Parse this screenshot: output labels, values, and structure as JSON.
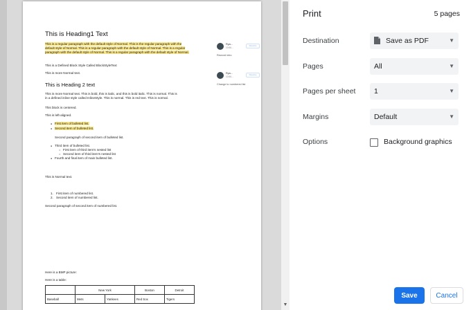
{
  "preview": {
    "heading1": "This is Heading1 Text",
    "normal_para": "This is a regular paragraph with the default style of Normal. This is the regular paragraph with the default style of Normal. This is a regular paragraph with the default style of Normal. This is a regular paragraph with the default style of Normal. This is a regular paragraph with the default style of Normal.",
    "block_style": "This is a Defined Block Style Called BlockStyleText",
    "more_normal": "This is more Normal text.",
    "heading2": "This is Heading 2 text",
    "inline_line1": "This is more Normal text. This is bold, this is italic, and this is bold italic. This is normal. This is",
    "inline_line2": "in a defined inline style called InlineStyle. This is normal. This is red text. This is normal.",
    "centered": "This block is centered.",
    "left_aligned": "This is left-aligned.",
    "bullet1": "First item of bulleted list.",
    "bullet2": "Second item of bulleted list.",
    "bullet2_para": "Second paragraph of second item of bulleted list.",
    "bullet3": "Third item of bulleted list.",
    "nested1": "First item of third item's nested list",
    "nested2": "Second item of third item's nested list",
    "bullet4": "Fourth and final item of main bulleted list.",
    "normal_text": "This is Normal text.",
    "num1": "First item of numbered list.",
    "num2": "Second item of numbered list.",
    "num_marker1": "1.",
    "num_marker2": "2.",
    "num2_para": "Second paragraph of second item of numbered list.",
    "bmp": "Here is a BMP picture:",
    "table_intro": "Here is a table:",
    "table": {
      "header": [
        "",
        "New York",
        "Boston",
        "Detroit"
      ],
      "row1": [
        "Baseball",
        "Mets",
        "Yankees",
        "Red Sox",
        "Tigers"
      ]
    },
    "comments": [
      {
        "name": "Rya...",
        "time": "10:56...",
        "resolve": "Resolve",
        "text": "Reword intro"
      },
      {
        "name": "Rya...",
        "time": "10:56...",
        "resolve": "Resolve",
        "text": "Change to numbered list"
      }
    ]
  },
  "panel": {
    "title": "Print",
    "page_count": "5 pages",
    "destination_label": "Destination",
    "destination_value": "Save as PDF",
    "pages_label": "Pages",
    "pages_value": "All",
    "pps_label": "Pages per sheet",
    "pps_value": "1",
    "margins_label": "Margins",
    "margins_value": "Default",
    "options_label": "Options",
    "background_graphics": "Background graphics",
    "background_graphics_checked": false,
    "save": "Save",
    "cancel": "Cancel",
    "accent_color": "#1a73e8"
  }
}
